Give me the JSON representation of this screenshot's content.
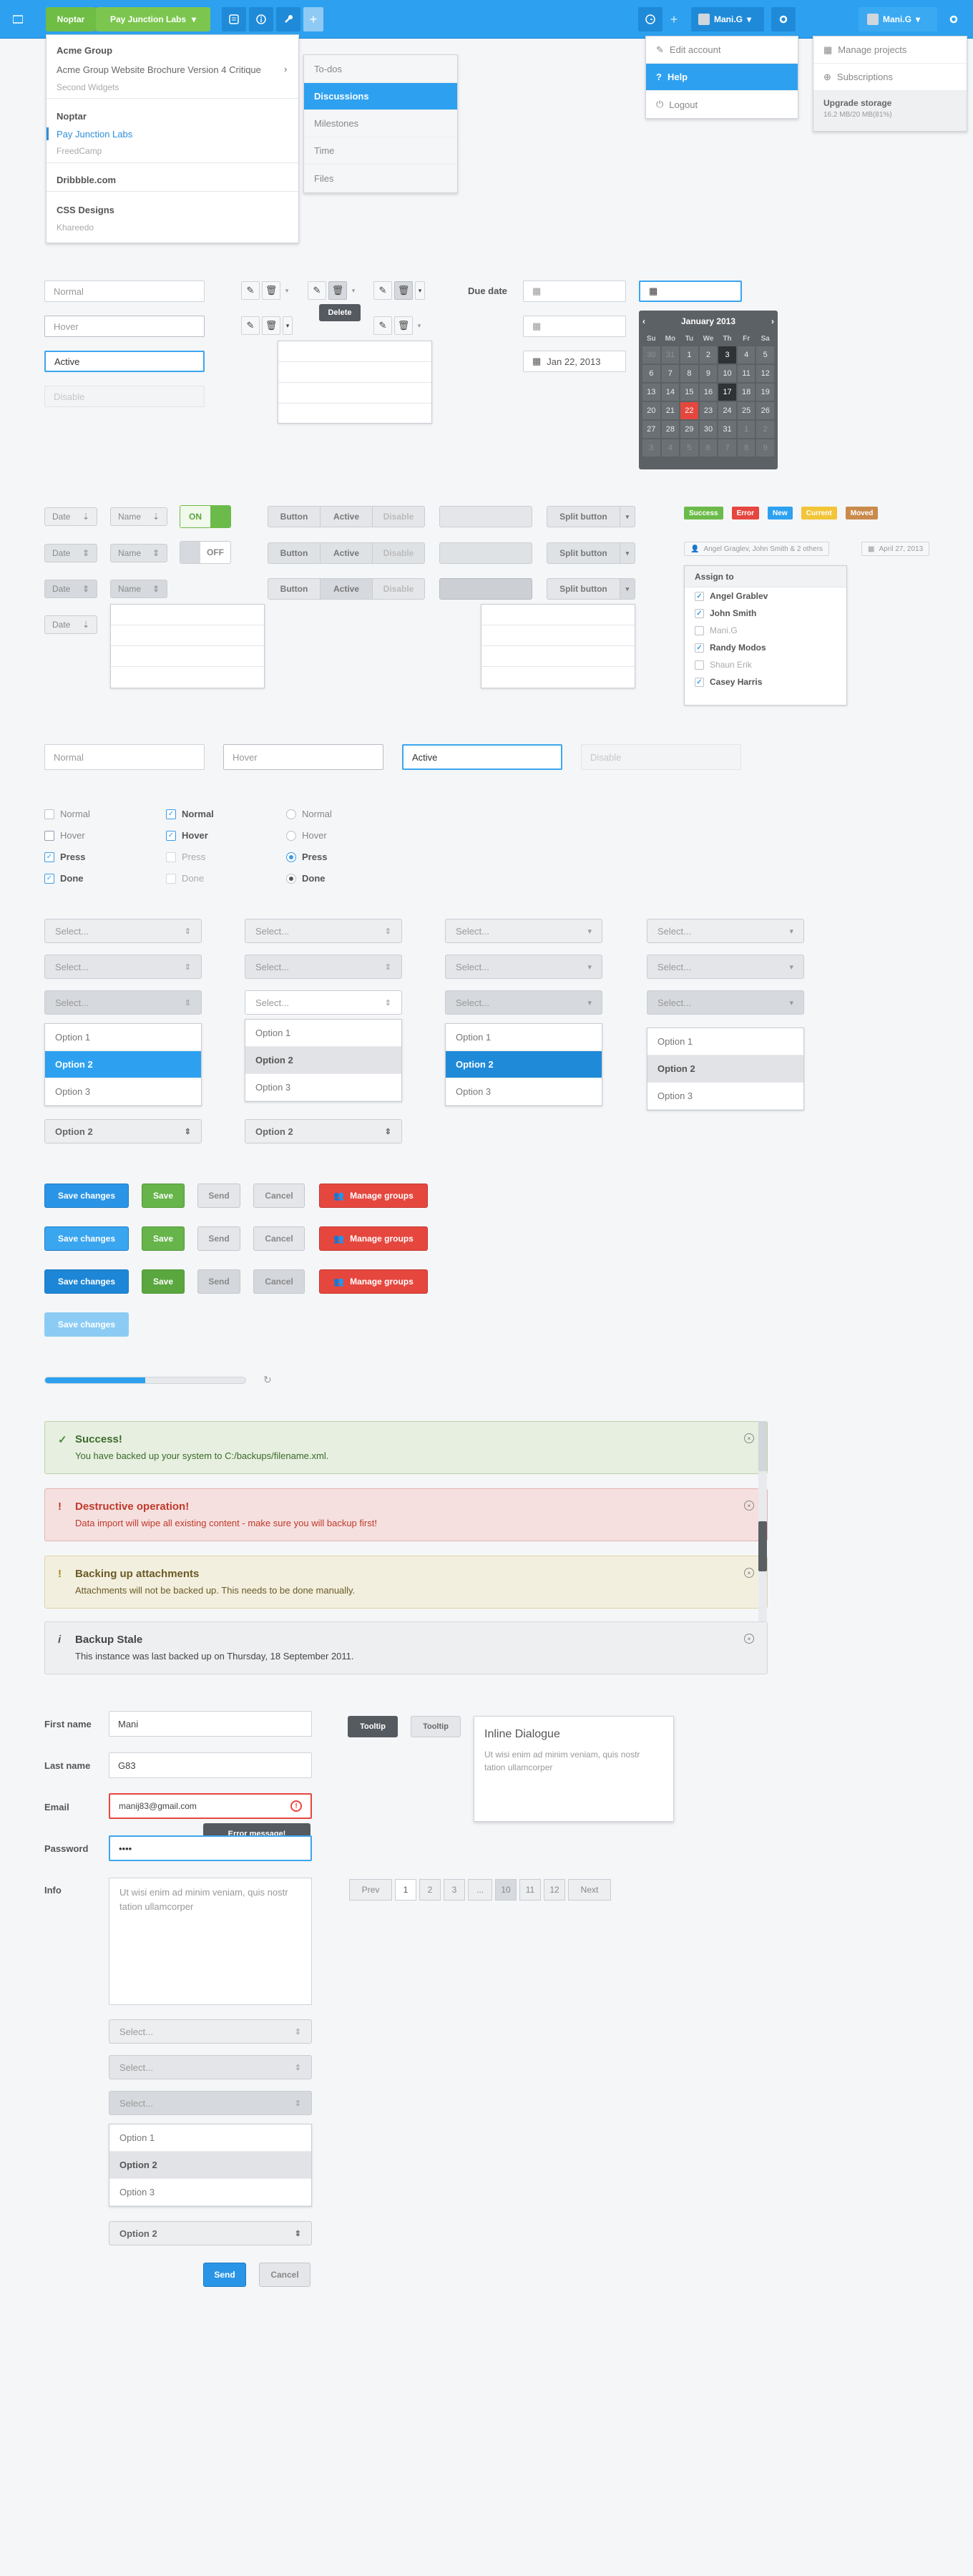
{
  "topbar": {
    "breadcrumb": [
      "Noptar",
      "Pay Junction Labs"
    ],
    "user_name": "Mani.G",
    "user_name_right": "Mani.G"
  },
  "projects_menu": {
    "groups": [
      {
        "title": "Acme Group",
        "items": [
          "Acme Group Website Brochure Version 4 Critique",
          "Second Widgets"
        ]
      },
      {
        "title": "Noptar",
        "items": [
          "Pay Junction Labs",
          "FreedCamp"
        ]
      },
      {
        "title": "Dribbble.com",
        "items": []
      },
      {
        "title": "CSS Designs",
        "items": [
          "Khareedo"
        ]
      }
    ]
  },
  "modules_menu": {
    "items": [
      "To-dos",
      "Discussions",
      "Milestones",
      "Time",
      "Files"
    ],
    "selected": 1
  },
  "account_menu": {
    "items": [
      "Edit account",
      "Help",
      "Logout"
    ],
    "selected": 1
  },
  "right_menu": {
    "items": [
      "Manage projects",
      "Subscriptions"
    ],
    "upgrade_title": "Upgrade storage",
    "storage": "16.2 MB/20 MB(81%)"
  },
  "inputs": {
    "normal": "Normal",
    "hover": "Hover",
    "active": "Active",
    "disable": "Disable"
  },
  "tooltip_delete": "Delete",
  "due_date": {
    "label": "Due date",
    "date_value": "Jan 22, 2013"
  },
  "calendar": {
    "month": "January 2013",
    "days": [
      "Su",
      "Mo",
      "Tu",
      "We",
      "Th",
      "Fr",
      "Sa"
    ],
    "weeks": [
      [
        "30",
        "31",
        "1",
        "2",
        "3",
        "4",
        "5"
      ],
      [
        "6",
        "7",
        "8",
        "9",
        "10",
        "11",
        "12"
      ],
      [
        "13",
        "14",
        "15",
        "16",
        "17",
        "18",
        "19"
      ],
      [
        "20",
        "21",
        "22",
        "23",
        "24",
        "25",
        "26"
      ],
      [
        "27",
        "28",
        "29",
        "30",
        "31",
        "1",
        "2"
      ],
      [
        "3",
        "4",
        "5",
        "6",
        "7",
        "8",
        "9"
      ]
    ]
  },
  "controls": {
    "date": "Date",
    "name": "Name",
    "toggle_on": "ON",
    "toggle_off": "OFF",
    "seg": [
      "Button",
      "Active",
      "Disable"
    ],
    "split": "Split button"
  },
  "badges": [
    {
      "label": "Success",
      "color": "#6cbb4a"
    },
    {
      "label": "Error",
      "color": "#e5473f"
    },
    {
      "label": "New",
      "color": "#2da1f0"
    },
    {
      "label": "Current",
      "color": "#f2c437"
    },
    {
      "label": "Moved",
      "color": "#c98a4b"
    }
  ],
  "people_tag": "Angel Graglev, John Smith & 2 others",
  "date_tag": "April 27, 2013",
  "assign": {
    "title": "Assign to",
    "people": [
      {
        "name": "Angel Grablev",
        "checked": true
      },
      {
        "name": "John Smith",
        "checked": true
      },
      {
        "name": "Mani.G",
        "checked": false
      },
      {
        "name": "Randy Modos",
        "checked": true
      },
      {
        "name": "Shaun Erik",
        "checked": false
      },
      {
        "name": "Casey Harris",
        "checked": true
      }
    ]
  },
  "checks": {
    "labels": [
      "Normal",
      "Hover",
      "Press",
      "Done"
    ]
  },
  "selects": {
    "placeholder": "Select...",
    "options": [
      "Option 1",
      "Option 2",
      "Option 3"
    ],
    "chosen": "Option 2"
  },
  "buttons": {
    "save_changes": "Save changes",
    "save": "Save",
    "send": "Send",
    "cancel": "Cancel",
    "manage_groups": "Manage groups"
  },
  "alerts": [
    {
      "title": "Success!",
      "msg": "You have backed up your system to C:/backups/filename.xml.",
      "kind": "success"
    },
    {
      "title": "Destructive operation!",
      "msg": "Data import will wipe all existing content - make sure you will backup first!",
      "kind": "error"
    },
    {
      "title": "Backing up attachments",
      "msg": "Attachments will not be backed up. This needs to be done manually.",
      "kind": "warning"
    },
    {
      "title": "Backup Stale",
      "msg": "This instance was last backed up on Thursday, 18 September 2011.",
      "kind": "info"
    }
  ],
  "form": {
    "first_name_label": "First name",
    "first_name": "Mani",
    "last_name_label": "Last name",
    "last_name": "G83",
    "email_label": "Email",
    "email": "manij83@gmail.com",
    "password_label": "Password",
    "password": "••••",
    "info_label": "Info",
    "info_text": "Ut wisi enim ad minim veniam, quis nostr tation ullamcorper",
    "error_msg": "Error message!",
    "send": "Send",
    "cancel": "Cancel"
  },
  "tooltips": [
    "Tooltip",
    "Tooltip"
  ],
  "inline_dialogue": {
    "title": "Inline Dialogue",
    "text": "Ut wisi enim ad minim veniam, quis nostr tation ullamcorper"
  },
  "pagination": {
    "prev": "Prev",
    "next": "Next",
    "pages": [
      "1",
      "2",
      "3",
      "...",
      "10",
      "11",
      "12"
    ]
  },
  "colors": {
    "accent": "#2da1f0",
    "green": "#6cbb4a",
    "red": "#e5473f"
  }
}
